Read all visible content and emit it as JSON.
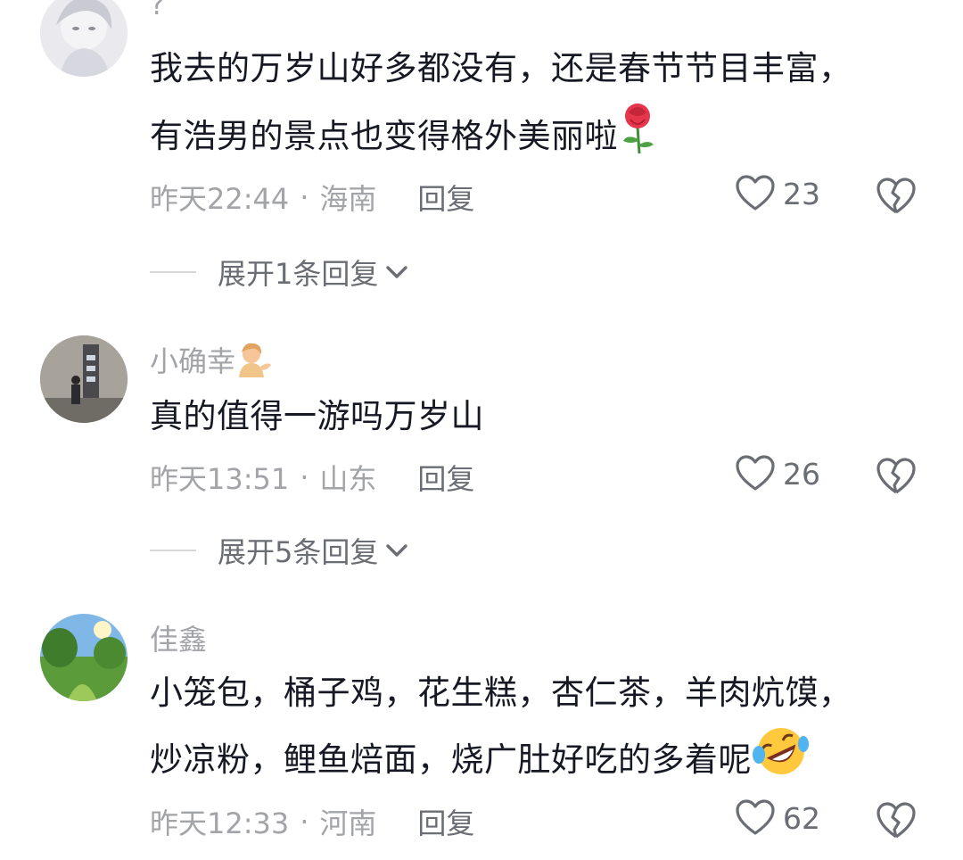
{
  "comments": [
    {
      "username": "?",
      "text_lines": [
        "我去的万岁山好多都没有，还是春节节目丰富，",
        "有浩男的景点也变得格外美丽啦"
      ],
      "emoji": "rose-emoji",
      "time": "昨天22:44",
      "location": "海南",
      "reply_label": "回复",
      "likes": "23",
      "expand_label": "展开1条回复"
    },
    {
      "username": "小确幸",
      "username_emoji": "person-tipping-hand-emoji",
      "text_lines": [
        "真的值得一游吗万岁山"
      ],
      "time": "昨天13:51",
      "location": "山东",
      "reply_label": "回复",
      "likes": "26",
      "expand_label": "展开5条回复"
    },
    {
      "username": "佳鑫",
      "text_lines": [
        "小笼包，桶子鸡，花生糕，杏仁茶，羊肉炕馍，",
        "炒凉粉，鲤鱼焙面，烧广肚好吃的多着呢"
      ],
      "emoji": "rolling-laughing-emoji",
      "time": "昨天12:33",
      "location": "河南",
      "reply_label": "回复",
      "likes": "62"
    }
  ],
  "separator": "·",
  "colors": {
    "text": "#161823",
    "meta": "#a3a4a8",
    "reply": "#6b6d74"
  }
}
